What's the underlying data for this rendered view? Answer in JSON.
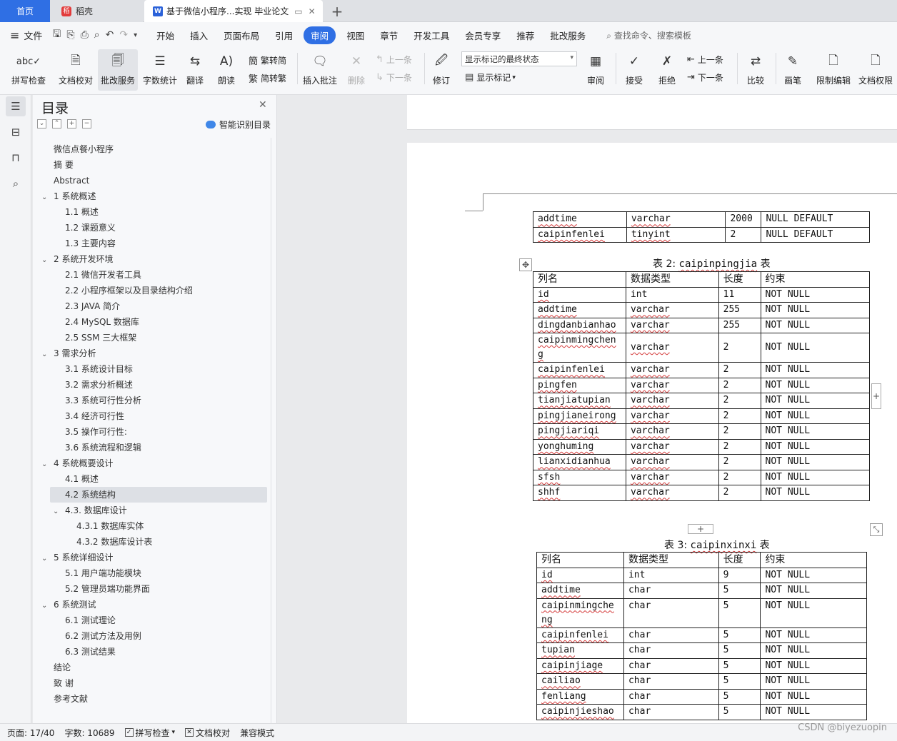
{
  "tabs": {
    "home": "首页",
    "daoke": "稻壳",
    "doc": "基于微信小程序...实现 毕业论文"
  },
  "menubar": {
    "file": "文件",
    "items": [
      "开始",
      "插入",
      "页面布局",
      "引用",
      "审阅",
      "视图",
      "章节",
      "开发工具",
      "会员专享",
      "推荐",
      "批改服务"
    ],
    "active": "审阅",
    "search": "查找命令、搜索模板"
  },
  "ribbon": {
    "spell": "拼写检查",
    "proofread": "文档校对",
    "correct": "批改服务",
    "wordcount": "字数统计",
    "translate": "翻译",
    "read": "朗读",
    "trad": "繁转简",
    "simp": "简转繁",
    "insert_comment": "插入批注",
    "delete": "删除",
    "prev": "上一条",
    "next": "下一条",
    "track": "修订",
    "markup_state": "显示标记的最终状态",
    "show_markup": "显示标记",
    "review": "审阅",
    "accept": "接受",
    "reject": "拒绝",
    "prev2": "上一条",
    "next2": "下一条",
    "compare": "比较",
    "pen": "画笔",
    "restrict": "限制编辑",
    "permission": "文档权限"
  },
  "toc": {
    "title": "目录",
    "smart": "智能识别目录",
    "items": [
      {
        "text": "微信点餐小程序",
        "level": 0,
        "chev": false
      },
      {
        "text": "摘  要",
        "level": 0,
        "chev": false
      },
      {
        "text": "Abstract",
        "level": 0,
        "chev": false
      },
      {
        "text": "1  系统概述",
        "level": 0,
        "chev": true
      },
      {
        "text": "1.1  概述",
        "level": 1,
        "chev": false
      },
      {
        "text": "1.2 课题意义",
        "level": 1,
        "chev": false
      },
      {
        "text": "1.3  主要内容",
        "level": 1,
        "chev": false
      },
      {
        "text": "2  系统开发环境",
        "level": 0,
        "chev": true
      },
      {
        "text": "2.1 微信开发者工具",
        "level": 1,
        "chev": false
      },
      {
        "text": "2.2 小程序框架以及目录结构介绍",
        "level": 1,
        "chev": false
      },
      {
        "text": "2.3 JAVA 简介",
        "level": 1,
        "chev": false
      },
      {
        "text": "2.4 MySQL 数据库",
        "level": 1,
        "chev": false
      },
      {
        "text": "2.5 SSM 三大框架",
        "level": 1,
        "chev": false
      },
      {
        "text": "3  需求分析",
        "level": 0,
        "chev": true
      },
      {
        "text": "3.1  系统设计目标",
        "level": 1,
        "chev": false
      },
      {
        "text": "3.2 需求分析概述",
        "level": 1,
        "chev": false
      },
      {
        "text": "3.3  系统可行性分析",
        "level": 1,
        "chev": false
      },
      {
        "text": "3.4 经济可行性",
        "level": 1,
        "chev": false
      },
      {
        "text": "3.5 操作可行性:",
        "level": 1,
        "chev": false
      },
      {
        "text": "3.6 系统流程和逻辑",
        "level": 1,
        "chev": false
      },
      {
        "text": "4 系统概要设计",
        "level": 0,
        "chev": true
      },
      {
        "text": "4.1  概述",
        "level": 1,
        "chev": false
      },
      {
        "text": "4.2  系统结构",
        "level": 1,
        "chev": false,
        "selected": true
      },
      {
        "text": "4.3.  数据库设计",
        "level": 1,
        "chev": true
      },
      {
        "text": "4.3.1  数据库实体",
        "level": 2,
        "chev": false
      },
      {
        "text": "4.3.2  数据库设计表",
        "level": 2,
        "chev": false
      },
      {
        "text": "5 系统详细设计",
        "level": 0,
        "chev": true
      },
      {
        "text": "5.1 用户端功能模块",
        "level": 1,
        "chev": false
      },
      {
        "text": "5.2 管理员端功能界面",
        "level": 1,
        "chev": false
      },
      {
        "text": "6  系统测试",
        "level": 0,
        "chev": true
      },
      {
        "text": "6.1  测试理论",
        "level": 1,
        "chev": false
      },
      {
        "text": "6.2  测试方法及用例",
        "level": 1,
        "chev": false
      },
      {
        "text": "6.3 测试结果",
        "level": 1,
        "chev": false
      },
      {
        "text": "结论",
        "level": 0,
        "chev": false
      },
      {
        "text": "致   谢",
        "level": 0,
        "chev": false
      },
      {
        "text": "参考文献",
        "level": 0,
        "chev": false
      }
    ]
  },
  "table1": {
    "rows": [
      [
        "addtime",
        "varchar",
        "2000",
        "NULL DEFAULT"
      ],
      [
        "caipinfenlei",
        "tinyint",
        "2",
        "NULL DEFAULT"
      ]
    ]
  },
  "table2": {
    "caption_prefix": "表 2:",
    "caption_name": "caipinpingjia",
    "caption_suffix": "表",
    "header": [
      "列名",
      "数据类型",
      "长度",
      "约束"
    ],
    "rows": [
      [
        "id",
        "int",
        "11",
        "NOT NULL"
      ],
      [
        "addtime",
        "varchar",
        "255",
        "NOT NULL"
      ],
      [
        "dingdanbianhao",
        "varchar",
        "255",
        "NOT NULL"
      ],
      [
        "caipinmingchen\ng",
        "varchar",
        "2",
        "NOT NULL"
      ],
      [
        "caipinfenlei",
        "varchar",
        "2",
        "NOT NULL"
      ],
      [
        "pingfen",
        "varchar",
        "2",
        "NOT NULL"
      ],
      [
        "tianjiatupian",
        "varchar",
        "2",
        "NOT NULL"
      ],
      [
        "pingjianeirong",
        "varchar",
        "2",
        "NOT NULL"
      ],
      [
        "pingjiariqi",
        "varchar",
        "2",
        "NOT NULL"
      ],
      [
        "yonghuming",
        "varchar",
        "2",
        "NOT NULL"
      ],
      [
        "lianxidianhua",
        "varchar",
        "2",
        "NOT NULL"
      ],
      [
        "sfsh",
        "varchar",
        "2",
        "NOT NULL"
      ],
      [
        "shhf",
        "varchar",
        "2",
        "NOT NULL"
      ]
    ]
  },
  "table3": {
    "caption_prefix": "表 3:",
    "caption_name": "caipinxinxi",
    "caption_suffix": "表",
    "header": [
      "列名",
      "数据类型",
      "长度",
      "约束"
    ],
    "rows": [
      [
        "id",
        "int",
        "9",
        "NOT NULL"
      ],
      [
        "addtime",
        "char",
        "5",
        "NOT NULL"
      ],
      [
        "caipinmingche\nng",
        "char",
        "5",
        "NOT NULL"
      ],
      [
        "caipinfenlei",
        "char",
        "5",
        "NOT NULL"
      ],
      [
        "tupian",
        "char",
        "5",
        "NOT NULL"
      ],
      [
        "caipinjiage",
        "char",
        "5",
        "NOT NULL"
      ],
      [
        "cailiao",
        "char",
        "5",
        "NOT NULL"
      ],
      [
        "fenliang",
        "char",
        "5",
        "NOT NULL"
      ],
      [
        "caipinjieshao",
        "char",
        "5",
        "NOT NULL"
      ]
    ]
  },
  "status": {
    "page": "页面: 17/40",
    "words": "字数: 10689",
    "spell": "拼写检查",
    "proof": "文档校对",
    "compat": "兼容模式"
  },
  "watermark": "CSDN @biyezuopin"
}
